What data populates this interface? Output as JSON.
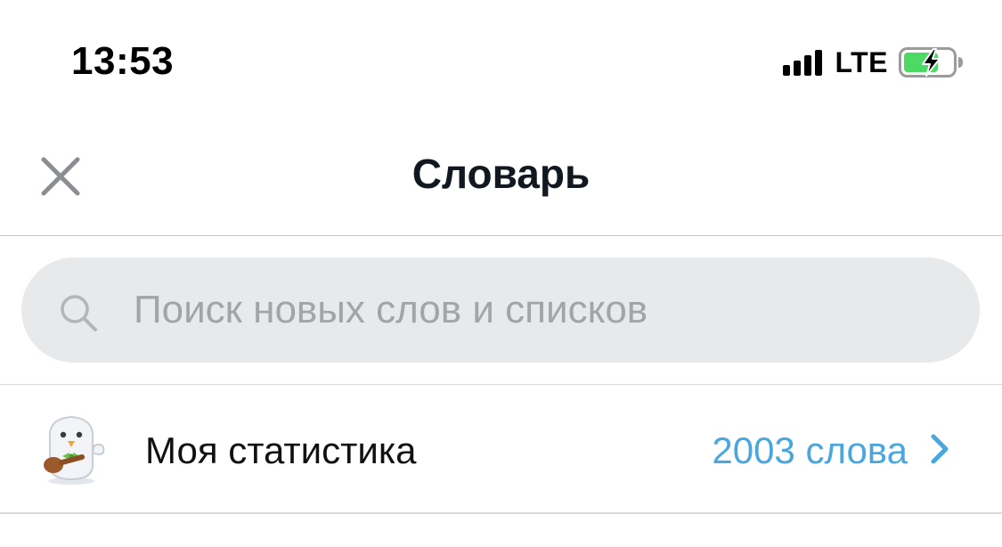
{
  "status_bar": {
    "time": "13:53",
    "network": "LTE"
  },
  "nav": {
    "title": "Словарь",
    "close_icon": "close-icon"
  },
  "search": {
    "placeholder": "Поиск новых слов и списков",
    "value": "",
    "icon": "search-icon"
  },
  "stats": {
    "label": "Моя статистика",
    "value": "2003 слова",
    "avatar_icon": "mascot-avatar",
    "chevron_icon": "chevron-right-icon"
  },
  "colors": {
    "accent": "#4aa7de",
    "battery_fill": "#4cd964",
    "search_bg": "#e8e9eb",
    "placeholder": "#a2a4a8",
    "close_icon": "#8a8d92"
  }
}
